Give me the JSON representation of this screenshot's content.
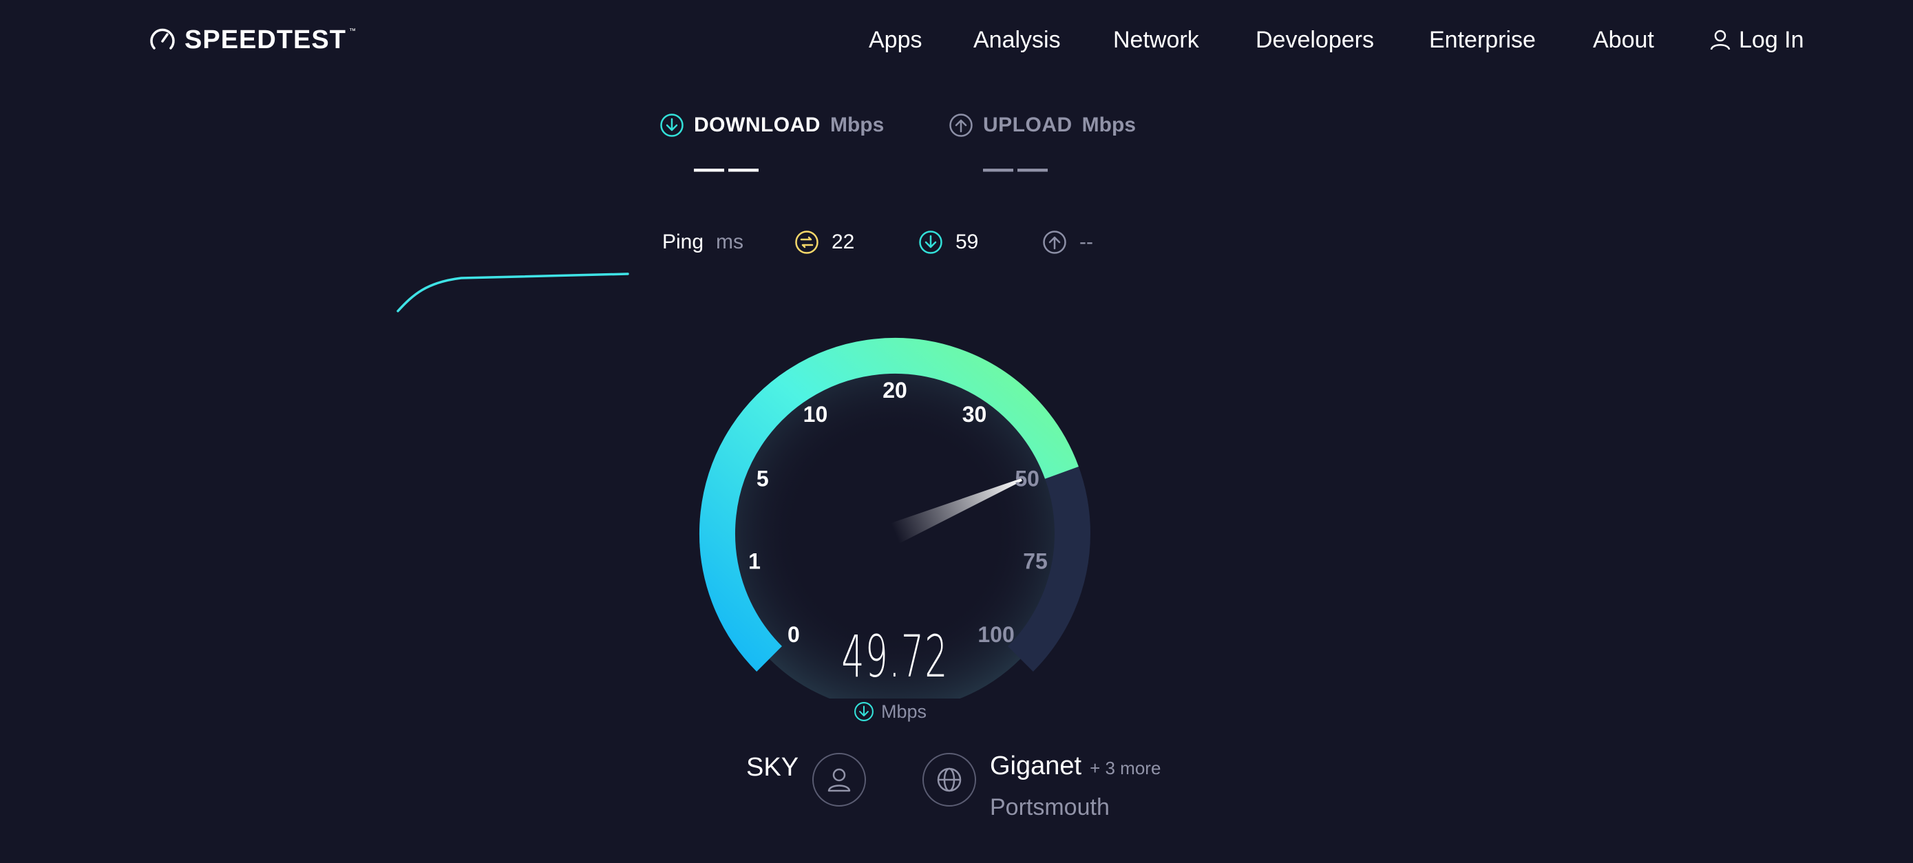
{
  "header": {
    "logo_text": "SPEEDTEST",
    "logo_tm": "™",
    "nav": {
      "apps": "Apps",
      "analysis": "Analysis",
      "network": "Network",
      "developers": "Developers",
      "enterprise": "Enterprise",
      "about": "About",
      "login": "Log In"
    }
  },
  "results": {
    "download_label": "DOWNLOAD",
    "download_unit": "Mbps",
    "download_value": "——",
    "upload_label": "UPLOAD",
    "upload_unit": "Mbps",
    "upload_value": "——"
  },
  "ping": {
    "label": "Ping",
    "unit": "ms",
    "idle": "22",
    "download": "59",
    "upload": "--"
  },
  "gauge": {
    "ticks": [
      "0",
      "1",
      "5",
      "10",
      "20",
      "30",
      "50",
      "75",
      "100"
    ],
    "current_value": "49.72",
    "unit": "Mbps",
    "needle_value": 49.72
  },
  "connection": {
    "isp": "SKY",
    "server_name": "Giganet",
    "server_more": "+ 3 more",
    "server_location": "Portsmouth"
  },
  "colors": {
    "background": "#141526",
    "accent_cyan": "#33e0d8",
    "gauge_start": "#13b6f6",
    "gauge_end": "#6bf59a",
    "track": "#222b47",
    "ping_yellow": "#f7d86a"
  },
  "icons": {
    "logo": "gauge-icon",
    "login": "user-icon",
    "download": "arrow-down-circle-icon",
    "upload": "arrow-up-circle-icon",
    "ping": "jitter-icon",
    "isp": "user-circle-icon",
    "server": "globe-icon"
  }
}
